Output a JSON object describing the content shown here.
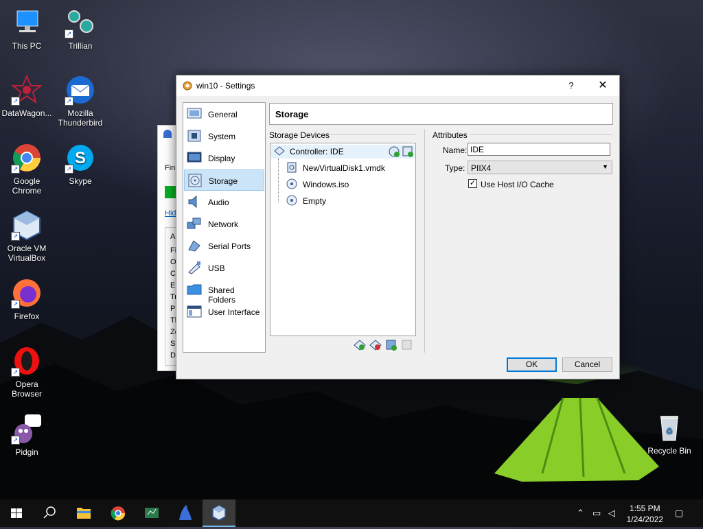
{
  "desktop": {
    "icons": [
      {
        "label": "This PC"
      },
      {
        "label": "Trillian"
      },
      {
        "label": "DataWagon..."
      },
      {
        "label": "Mozilla Thunderbird"
      },
      {
        "label": "Google Chrome"
      },
      {
        "label": "Skype"
      },
      {
        "label": "Oracle VM VirtualBox"
      },
      {
        "label": "Firefox"
      },
      {
        "label": "Opera Browser"
      },
      {
        "label": "Pidgin"
      }
    ],
    "recycle_bin": "Recycle Bin"
  },
  "background_window": {
    "lines": [
      "Fini",
      "Hid",
      "A",
      "Fi",
      "O",
      "C",
      "E",
      "Tr",
      "Pr",
      "Th",
      "Zo",
      "Sh",
      "Di"
    ]
  },
  "dialog": {
    "title": "win10 - Settings",
    "help": "?",
    "close": "✕",
    "sidebar": [
      {
        "label": "General",
        "icon": "general-icon"
      },
      {
        "label": "System",
        "icon": "system-icon"
      },
      {
        "label": "Display",
        "icon": "display-icon"
      },
      {
        "label": "Storage",
        "icon": "storage-icon",
        "active": true
      },
      {
        "label": "Audio",
        "icon": "audio-icon"
      },
      {
        "label": "Network",
        "icon": "network-icon"
      },
      {
        "label": "Serial Ports",
        "icon": "serial-ports-icon"
      },
      {
        "label": "USB",
        "icon": "usb-icon"
      },
      {
        "label": "Shared Folders",
        "icon": "shared-folders-icon"
      },
      {
        "label": "User Interface",
        "icon": "user-interface-icon"
      }
    ],
    "section_title": "Storage",
    "storage_devices_label": "Storage Devices",
    "attributes_label": "Attributes",
    "tree": {
      "controller": "Controller: IDE",
      "items": [
        "NewVirtualDisk1.vmdk",
        "Windows.iso",
        "Empty"
      ]
    },
    "attributes": {
      "name_label": "Name:",
      "name_value": "IDE",
      "type_label": "Type:",
      "type_value": "PIIX4",
      "cache_label": "Use Host I/O Cache",
      "cache_checked": true
    },
    "ok": "OK",
    "cancel": "Cancel"
  },
  "taskbar": {
    "time": "1:55 PM",
    "date": "1/24/2022"
  },
  "colors": {
    "accent": "#0078d7",
    "selection": "#cce4f7"
  }
}
